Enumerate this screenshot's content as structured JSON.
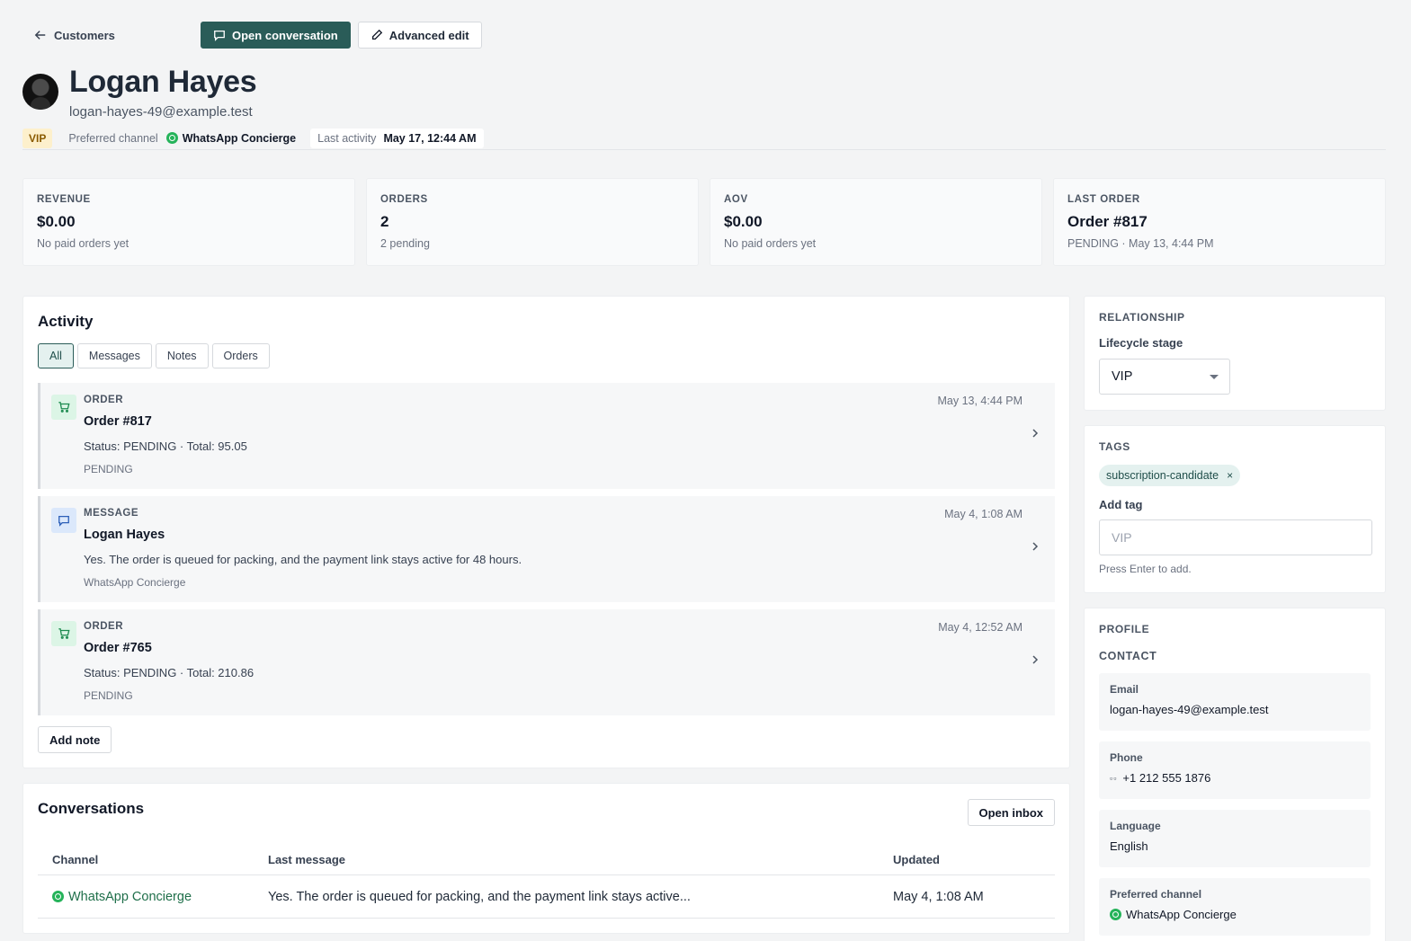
{
  "nav": {
    "back_label": "Customers",
    "open_conversation_label": "Open conversation",
    "advanced_edit_label": "Advanced edit"
  },
  "customer": {
    "name": "Logan Hayes",
    "email": "logan-hayes-49@example.test",
    "badge": "VIP",
    "preferred_channel_label": "Preferred channel",
    "preferred_channel": "WhatsApp Concierge",
    "last_activity_label": "Last activity",
    "last_activity": "May 17, 12:44 AM"
  },
  "stats": [
    {
      "label": "REVENUE",
      "value": "$0.00",
      "sub": "No paid orders yet"
    },
    {
      "label": "ORDERS",
      "value": "2",
      "sub": "2 pending"
    },
    {
      "label": "AOV",
      "value": "$0.00",
      "sub": "No paid orders yet"
    },
    {
      "label": "LAST ORDER",
      "value": "Order #817",
      "sub": "PENDING · May 13, 4:44 PM"
    }
  ],
  "activity": {
    "title": "Activity",
    "filters": [
      "All",
      "Messages",
      "Notes",
      "Orders"
    ],
    "active_filter": "All",
    "items": [
      {
        "kind": "order",
        "type": "ORDER",
        "title": "Order #817",
        "desc": "Status: PENDING · Total: 95.05",
        "meta": "PENDING",
        "date": "May 13, 4:44 PM"
      },
      {
        "kind": "message",
        "type": "MESSAGE",
        "title": "Logan Hayes",
        "desc": "Yes. The order is queued for packing, and the payment link stays active for 48 hours.",
        "meta": "WhatsApp Concierge",
        "date": "May 4, 1:08 AM"
      },
      {
        "kind": "order",
        "type": "ORDER",
        "title": "Order #765",
        "desc": "Status: PENDING · Total: 210.86",
        "meta": "PENDING",
        "date": "May 4, 12:52 AM"
      }
    ],
    "add_note_label": "Add note"
  },
  "conversations": {
    "title": "Conversations",
    "open_inbox_label": "Open inbox",
    "columns": [
      "Channel",
      "Last message",
      "Updated"
    ],
    "rows": [
      {
        "channel": "WhatsApp Concierge",
        "last_message": "Yes. The order is queued for packing, and the payment link stays active...",
        "updated": "May 4, 1:08 AM"
      }
    ]
  },
  "relationship": {
    "section": "RELATIONSHIP",
    "lifecycle_label": "Lifecycle stage",
    "lifecycle_value": "VIP"
  },
  "tags": {
    "section": "TAGS",
    "items": [
      "subscription-candidate"
    ],
    "remove_glyph": "×",
    "add_label": "Add tag",
    "placeholder": "VIP",
    "hint": "Press Enter to add."
  },
  "profile": {
    "section": "PROFILE",
    "contact_label": "CONTACT",
    "email_label": "Email",
    "email": "logan-hayes-49@example.test",
    "phone_label": "Phone",
    "phone_flag": "▫▫",
    "phone": "+1 212 555 1876",
    "language_label": "Language",
    "language": "English",
    "channel_label": "Preferred channel",
    "channel": "WhatsApp Concierge"
  },
  "colors": {
    "primary": "#2a5c58",
    "whatsapp": "#25b35a",
    "vip_bg": "#fdf0cc",
    "order_icon_bg": "#dcf5e6",
    "message_icon_bg": "#dbe8fb"
  }
}
